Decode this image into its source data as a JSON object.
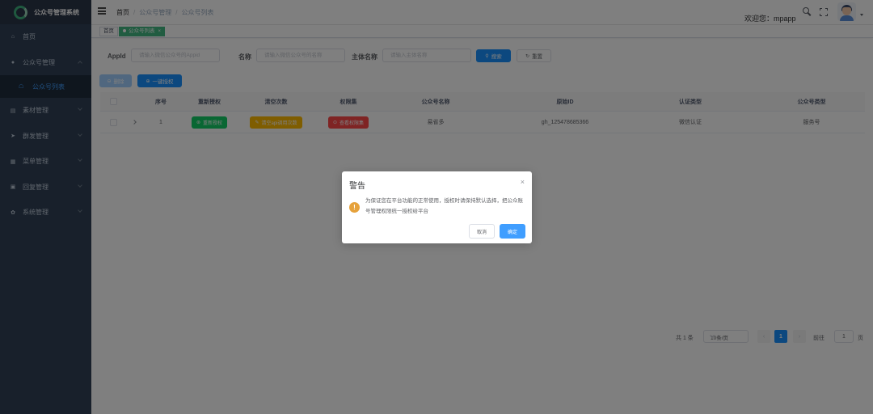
{
  "app": {
    "title": "公众号管理系统"
  },
  "sidebar": {
    "items": [
      {
        "label": "首页",
        "icon": "home-icon"
      },
      {
        "label": "公众号管理",
        "icon": "wechat-icon",
        "expanded": true,
        "children": [
          {
            "label": "公众号列表",
            "icon": "list-icon",
            "active": true
          }
        ]
      },
      {
        "label": "素材管理",
        "icon": "material-icon"
      },
      {
        "label": "群发管理",
        "icon": "send-icon"
      },
      {
        "label": "菜单管理",
        "icon": "menu-icon"
      },
      {
        "label": "回复管理",
        "icon": "reply-icon"
      },
      {
        "label": "系统管理",
        "icon": "gear-icon"
      }
    ]
  },
  "header": {
    "breadcrumb": [
      "首页",
      "公众号管理",
      "公众号列表"
    ],
    "welcome": "欢迎您：mpapp"
  },
  "tags": {
    "home": "首页",
    "active": "公众号列表",
    "close": "×"
  },
  "filters": {
    "appid_label": "AppId",
    "appid_placeholder": "请输入微信公众号的Appid",
    "name_label": "名称",
    "name_placeholder": "请输入微信公众号的名称",
    "subject_label": "主体名称",
    "subject_placeholder": "请输入主体名称",
    "search_label": "搜索",
    "reset_label": "重置"
  },
  "toolbar": {
    "delete_label": "删除",
    "authorize_label": "一键授权"
  },
  "table": {
    "columns": [
      "序号",
      "重新授权",
      "清空次数",
      "权限集",
      "公众号名称",
      "原始ID",
      "认证类型",
      "公众号类型"
    ],
    "rows": [
      {
        "index": "1",
        "reauth_label": "重新授权",
        "clear_label": "清空api调用次数",
        "perm_label": "查看权限集",
        "name": "易省多",
        "original_id": "gh_125478685366",
        "auth_type": "微信认证",
        "account_type": "服务号"
      }
    ]
  },
  "pagination": {
    "total": "共 1 条",
    "page_size": "10条/页",
    "prev": "‹",
    "current": "1",
    "next": "›",
    "goto": "前往",
    "goto_value": "1",
    "page_unit": "页"
  },
  "dialog": {
    "title": "警告",
    "close": "×",
    "message": "为保证您在平台功能的正常使用，授权时请保持默认选择，把公众账号管理权限统一授权给平台",
    "cancel_label": "取消",
    "confirm_label": "确定"
  },
  "colors": {
    "sidebar_bg": "#304156",
    "primary": "#1890ff",
    "success": "#13ce66",
    "warning": "#ffba00",
    "danger": "#ff4949",
    "tag_active": "#42b983"
  }
}
